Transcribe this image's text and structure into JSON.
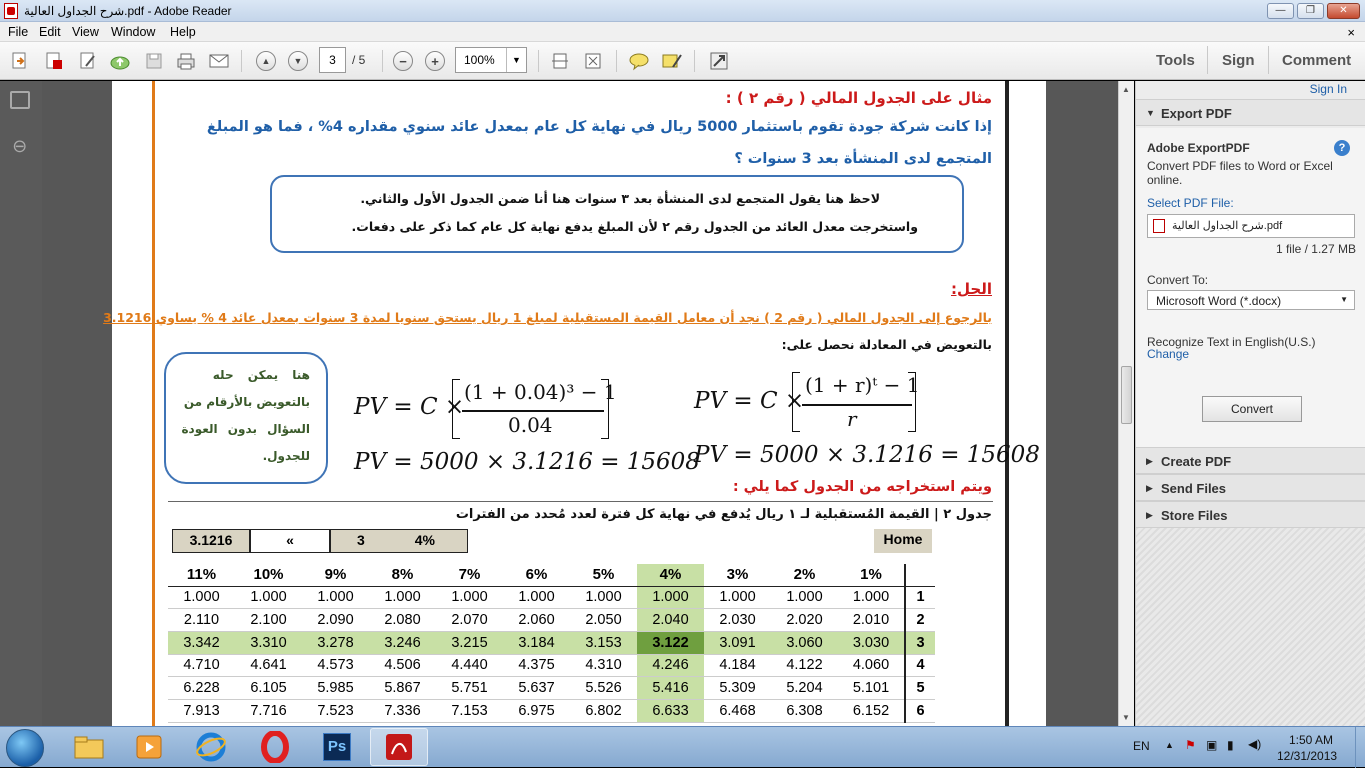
{
  "window": {
    "title": "شرح الجداول العالية.pdf - Adobe Reader",
    "btn_min": "—",
    "btn_max": "❐",
    "btn_close": "✕"
  },
  "menu": {
    "file": "File",
    "edit": "Edit",
    "view": "View",
    "window": "Window",
    "help": "Help",
    "close": "×"
  },
  "toolbar": {
    "page_current": "3",
    "page_total": "/ 5",
    "zoom": "100%",
    "zoom_arrow": "▼",
    "zoom_out": "−",
    "zoom_in": "+",
    "prev_page": "▲",
    "next_page": "▼",
    "tools": "Tools",
    "sign": "Sign",
    "comment": "Comment"
  },
  "doc": {
    "heading": "مثال على الجدول المالي ( رقم ٢ ) :",
    "question_line1": "إذا كانت شركة جودة تقوم باستثمار 5000 ريال في نهاية كل عام بمعدل عائد سنوي مقداره 4% ، فما هو المبلغ",
    "question_line2": "المتجمع لدى المنشأة بعد 3 سنوات ؟",
    "note_line1": "لاحظ هنا يقول المتجمع لدى المنشأة بعد ٣ سنوات هنا أنا ضمن الجدول الأول والثاني.",
    "note_line2": "واستخرجت معدل العائد من الجدول رقم ٢ لأن المبلغ يدفع نهاية كل عام كما ذكر على دفعات.",
    "solution_label": "الحل:",
    "ref_line": "بالرجوع إلى الجدول المالي ( رقم 2 ) نجد أن معامل القيمة المستقبلية لمبلغ 1 ريال يستحق سنويا لمدة 3 سنوات بمعدل عائد 4 % يساوي 3.1216",
    "substitute_line": "بالتعويض في المعادلة نحصل على:",
    "bubble_line1": "هنا يمكن حله",
    "bubble_line2": "بالتعويض بالأرقام من",
    "bubble_line3": "السؤال بدون العودة",
    "bubble_line4": "للجدول.",
    "formula_general_lhs": "PV = C ×",
    "formula_general_num": "(1 + r)ᵗ − 1",
    "formula_general_den": "r",
    "formula_specific_lhs": "PV = C ×",
    "formula_specific_num": "(1 + 0.04)³ − 1",
    "formula_specific_den": "0.04",
    "result_general": "PV = 5000 × 3.1216 = 15608",
    "result_specific": "PV = 5000 × 3.1216 = 15608",
    "extract_line": "ويتم استخراجه من الجدول كما يلي :",
    "table_title": "جدول ٢ | القيمة المُستقبلية لـ ١ ريال يُدفع في نهاية كل فترة لعدد مُحدد من الفترات",
    "calc_result": "3.1216",
    "calc_arrow": "«",
    "calc_n": "3",
    "calc_rate": "4%",
    "home_label": "Home"
  },
  "fv_table": {
    "headers": [
      "11%",
      "10%",
      "9%",
      "8%",
      "7%",
      "6%",
      "5%",
      "4%",
      "3%",
      "2%",
      "1%",
      ""
    ],
    "rows": [
      {
        "n": "1",
        "values": [
          "1.000",
          "1.000",
          "1.000",
          "1.000",
          "1.000",
          "1.000",
          "1.000",
          "1.000",
          "1.000",
          "1.000",
          "1.000"
        ]
      },
      {
        "n": "2",
        "values": [
          "2.110",
          "2.100",
          "2.090",
          "2.080",
          "2.070",
          "2.060",
          "2.050",
          "2.040",
          "2.030",
          "2.020",
          "2.010"
        ]
      },
      {
        "n": "3",
        "values": [
          "3.342",
          "3.310",
          "3.278",
          "3.246",
          "3.215",
          "3.184",
          "3.153",
          "3.122",
          "3.091",
          "3.060",
          "3.030"
        ]
      },
      {
        "n": "4",
        "values": [
          "4.710",
          "4.641",
          "4.573",
          "4.506",
          "4.440",
          "4.375",
          "4.310",
          "4.246",
          "4.184",
          "4.122",
          "4.060"
        ]
      },
      {
        "n": "5",
        "values": [
          "6.228",
          "6.105",
          "5.985",
          "5.867",
          "5.751",
          "5.637",
          "5.526",
          "5.416",
          "5.309",
          "5.204",
          "5.101"
        ]
      },
      {
        "n": "6",
        "values": [
          "7.913",
          "7.716",
          "7.523",
          "7.336",
          "7.153",
          "6.975",
          "6.802",
          "6.633",
          "6.468",
          "6.308",
          "6.152"
        ]
      }
    ],
    "highlight_col": 7,
    "highlight_row": 2,
    "highlight_color": "#c8e0a5",
    "highlight_strong": "#6f9f3f"
  },
  "panel": {
    "signin": "Sign In",
    "export_pdf": "Export PDF",
    "adobe_exportpdf": "Adobe ExportPDF",
    "desc": "Convert PDF files to Word or Excel online.",
    "help": "?",
    "select_label": "Select PDF File:",
    "file_name": "شرح الجداول العالية.pdf",
    "file_info": "1 file / 1.27 MB",
    "convert_to": "Convert To:",
    "format": "Microsoft Word (*.docx)",
    "recognize": "Recognize Text in English(U.S.)",
    "change": "Change",
    "convert_btn": "Convert",
    "create_pdf": "Create PDF",
    "send_files": "Send Files",
    "store_files": "Store Files",
    "expanded_arrow": "▼",
    "collapsed_arrow": "▶"
  },
  "taskbar": {
    "lang": "EN",
    "time": "1:50 AM",
    "date": "12/31/2013",
    "ps_label": "Ps"
  },
  "colors": {
    "accent_blue": "#1f5fa8",
    "doc_orange": "#e07a18",
    "doc_red": "#cc1a1a",
    "note_border": "#3f74b6"
  }
}
